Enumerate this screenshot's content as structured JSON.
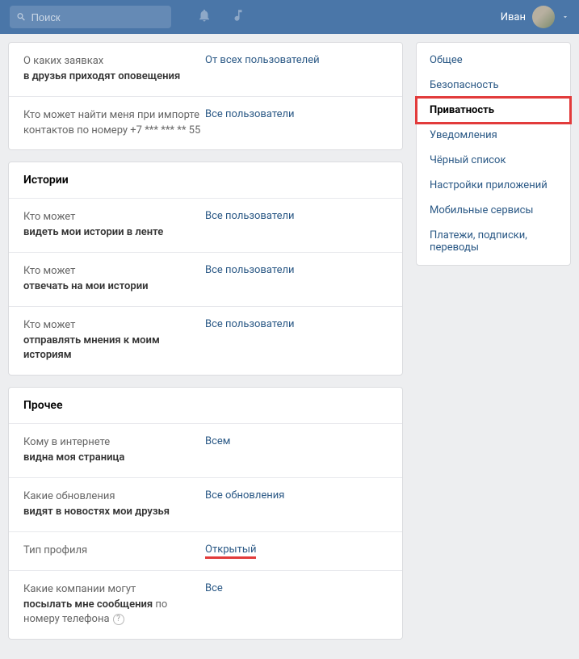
{
  "header": {
    "search_placeholder": "Поиск",
    "username": "Иван"
  },
  "contacts": {
    "rows": [
      {
        "label_pre": "О каких заявках",
        "label_bold": "в друзья приходят оповещения",
        "label_post": "",
        "value": "От всех пользователей"
      },
      {
        "label_pre": "Кто может найти меня при импорте контактов по номеру +7 *** *** ** 55",
        "label_bold": "",
        "label_post": "",
        "value": "Все пользователи"
      }
    ]
  },
  "stories": {
    "title": "Истории",
    "rows": [
      {
        "label_pre": "Кто может",
        "label_bold": "видеть мои истории в ленте",
        "value": "Все пользователи"
      },
      {
        "label_pre": "Кто может",
        "label_bold": "отвечать на мои истории",
        "value": "Все пользователи"
      },
      {
        "label_pre": "Кто может",
        "label_bold": "отправлять мнения к моим историям",
        "value": "Все пользователи"
      }
    ]
  },
  "other": {
    "title": "Прочее",
    "rows": [
      {
        "label_pre": "Кому в интернете",
        "label_bold": "видна моя страница",
        "value": "Всем",
        "highlight": false
      },
      {
        "label_pre": "Какие обновления",
        "label_bold": "видят в новостях мои друзья",
        "value": "Все обновления",
        "highlight": false
      },
      {
        "label_pre": "Тип профиля",
        "label_bold": "",
        "value": "Открытый",
        "highlight": true
      },
      {
        "label_pre": "Какие компании могут",
        "label_bold": "посылать мне сообщения",
        "label_post": " по номеру телефона",
        "value": "Все",
        "highlight": false,
        "help": true
      }
    ]
  },
  "sidebar": {
    "items": [
      {
        "label": "Общее",
        "active": false
      },
      {
        "label": "Безопасность",
        "active": false
      },
      {
        "label": "Приватность",
        "active": true
      },
      {
        "label": "Уведомления",
        "active": false
      },
      {
        "label": "Чёрный список",
        "active": false
      },
      {
        "label": "Настройки приложений",
        "active": false
      },
      {
        "label": "Мобильные сервисы",
        "active": false
      },
      {
        "label": "Платежи, подписки, переводы",
        "active": false
      }
    ]
  }
}
